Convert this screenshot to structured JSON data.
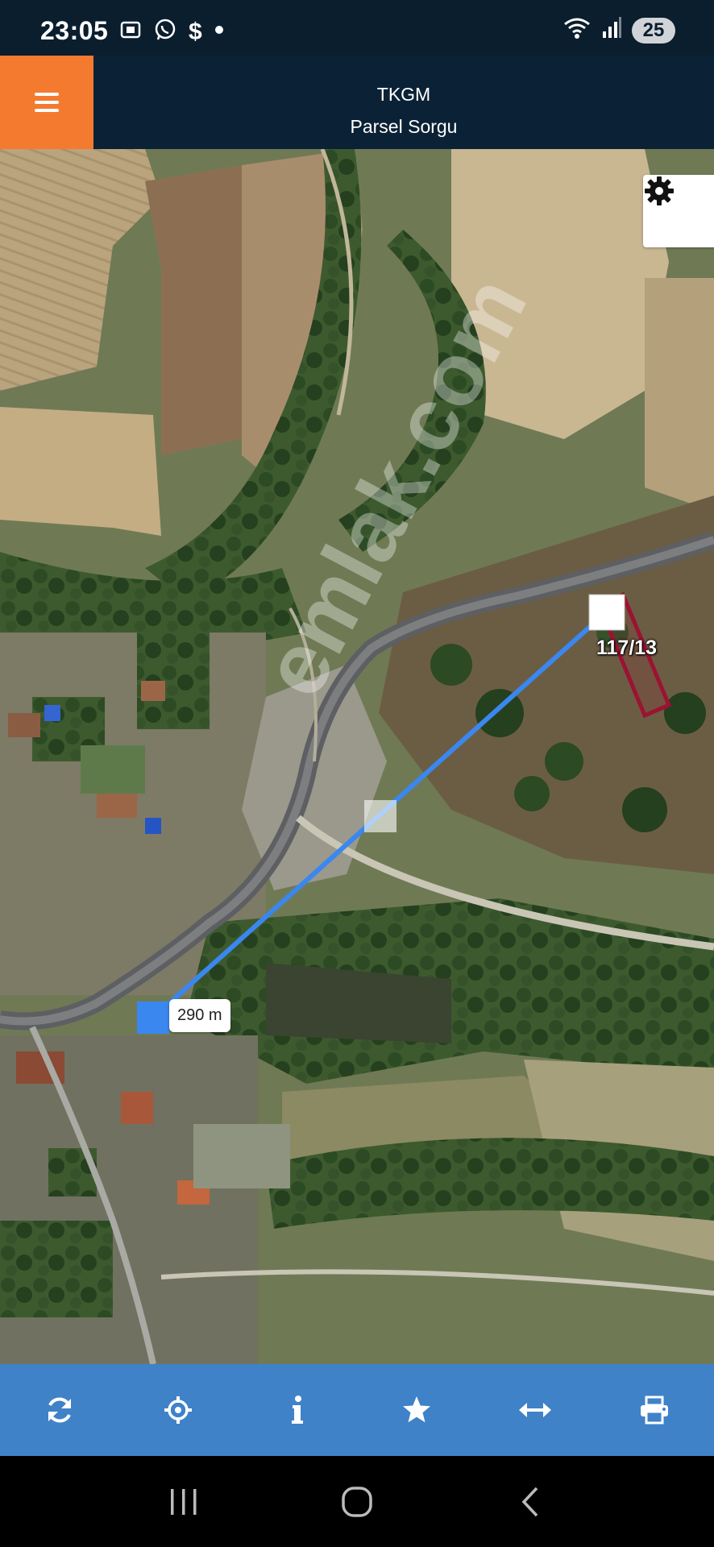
{
  "status_bar": {
    "time": "23:05",
    "battery": "25",
    "icons": [
      "screenshot-icon",
      "whatsapp-icon",
      "dollar-icon",
      "dot-icon",
      "wifi-icon",
      "signal-icon"
    ]
  },
  "header": {
    "title": "TKGM",
    "subtitle": "Parsel Sorgu"
  },
  "map": {
    "parcel_label": "117/13",
    "distance_label": "290 m",
    "measure_line_color": "#3b87f0",
    "parcel_outline_color": "#9c1232"
  },
  "toolbar": {
    "buttons": [
      "refresh-icon",
      "crosshair-icon",
      "info-icon",
      "star-icon",
      "measure-icon",
      "print-icon"
    ]
  },
  "colors": {
    "accent": "#f37a2f",
    "header_bg": "#0b2236",
    "toolbar_bg": "#3f82c8"
  }
}
